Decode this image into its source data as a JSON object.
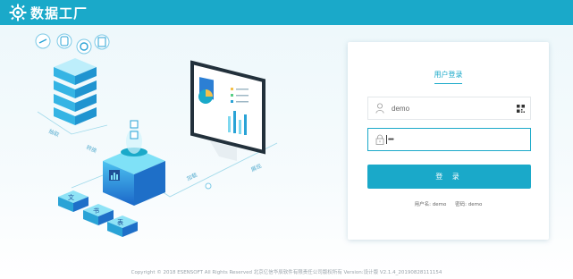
{
  "header": {
    "title": "数据工厂"
  },
  "illustration": {
    "labels": [
      "抽取",
      "转换",
      "加载",
      "展现"
    ],
    "blocks": [
      "文",
      "书",
      "表"
    ]
  },
  "login": {
    "title": "用户登录",
    "username_value": "demo",
    "password_mask": "••••",
    "button_label": "登 录",
    "hint_user": "用户名: demo",
    "hint_pass": "密码: demo"
  },
  "footer": {
    "text": "Copyright © 2018 ESENSOFT All Rights Reserved 北京亿信华辰软件有限责任公司版权所有 Version:设计版 V2.1.4_20190828111154"
  },
  "colors": {
    "brand": "#1aa9c9",
    "background": "#eef8fb"
  }
}
